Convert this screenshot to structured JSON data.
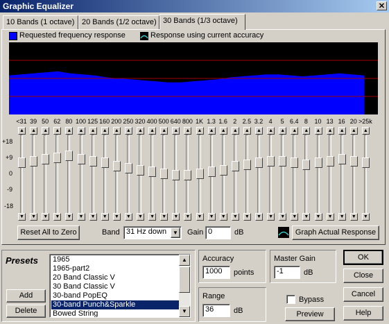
{
  "window": {
    "title": "Graphic Equalizer",
    "close_glyph": "✕"
  },
  "tabs": [
    {
      "label": "10 Bands (1 octave)"
    },
    {
      "label": "20 Bands (1/2 octave)"
    },
    {
      "label": "30 Bands (1/3 octave)"
    }
  ],
  "legend": {
    "requested": "Requested frequency response",
    "actual": "Response using current accuracy",
    "requested_color": "#0000ff"
  },
  "graph": {
    "band_db": [
      3,
      4,
      5,
      6,
      7,
      5,
      4,
      3,
      1,
      0,
      -1,
      -2,
      -3,
      -4,
      -4,
      -3,
      -2,
      -1,
      1,
      2,
      3,
      4,
      4,
      3,
      2,
      3,
      4,
      5,
      4,
      3
    ]
  },
  "frequencies": [
    "<31",
    "39",
    "50",
    "62",
    "80",
    "100",
    "125",
    "160",
    "200",
    "250",
    "320",
    "400",
    "500",
    "640",
    "800",
    "1K",
    "1.3",
    "1.6",
    "2",
    "2.5",
    "3.2",
    "4",
    "5",
    "6.4",
    "8",
    "10",
    "13",
    "16",
    "20",
    ">25k"
  ],
  "scale_labels": [
    "+18",
    "+9",
    "0",
    "-9",
    "-18"
  ],
  "controls": {
    "reset_label": "Reset All to Zero",
    "band_label": "Band",
    "band_value": "31 Hz down",
    "gain_label": "Gain",
    "gain_value": "0",
    "gain_unit": "dB",
    "graph_actual_label": "Graph Actual Response"
  },
  "presets": {
    "title": "Presets",
    "add": "Add",
    "delete": "Delete",
    "items": [
      "1965",
      "1965-part2",
      "20 Band Classic V",
      "30 Band Classic V",
      "30-band PopEQ",
      "30-band Punch&Sparkle",
      "Bowed String"
    ],
    "selected_index": 5
  },
  "accuracy": {
    "title": "Accuracy",
    "value": "1000",
    "unit": "points"
  },
  "range": {
    "title": "Range",
    "value": "36",
    "unit": "dB"
  },
  "master_gain": {
    "title": "Master Gain",
    "value": "-1",
    "unit": "dB"
  },
  "bypass": {
    "label": "Bypass",
    "checked": false
  },
  "buttons": {
    "ok": "OK",
    "close": "Close",
    "cancel": "Cancel",
    "preview": "Preview",
    "help": "Help"
  }
}
